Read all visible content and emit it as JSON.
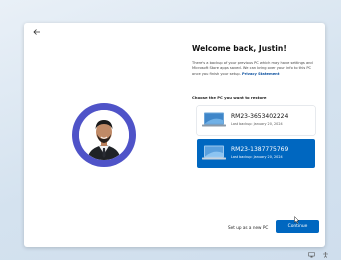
{
  "header": {
    "title": "Welcome back, Justin!",
    "description": "There's a backup of your previous PC which may have settings and Microsoft Store apps saved. We can bring over your info to this PC once you finish your setup.",
    "privacy_link": "Privacy Statement"
  },
  "restore": {
    "prompt": "Choose the PC you want to restore",
    "pcs": [
      {
        "name": "RM23-3653402224",
        "last_backup": "Last backup: January 20, 2024",
        "selected": false
      },
      {
        "name": "RM23-1387775769",
        "last_backup": "Last backup: January 20, 2024",
        "selected": true
      }
    ]
  },
  "actions": {
    "setup_new": "Set up as a new PC",
    "continue": "Continue"
  },
  "colors": {
    "accent": "#0067c0",
    "avatar_ring": "#4f53c8"
  },
  "icons": {
    "back": "arrow-left-icon",
    "pc": "laptop-icon",
    "tray_left": "network-icon",
    "tray_right": "accessibility-icon"
  }
}
